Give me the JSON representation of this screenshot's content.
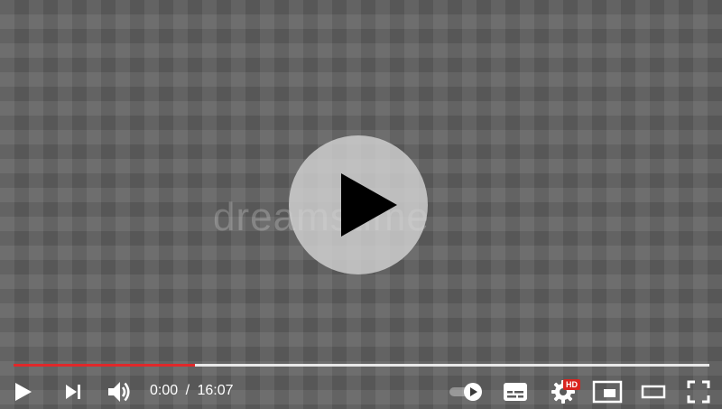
{
  "watermark": "dreamstime",
  "progress": {
    "played_fraction": 0.261
  },
  "time": {
    "current": "0:00",
    "separator": "/",
    "duration": "16:07"
  },
  "badges": {
    "hd": "HD"
  },
  "colors": {
    "progress_played": "#e0282a",
    "hd_badge": "#d9241f"
  },
  "icons": {
    "big_play": "play-icon",
    "play": "play-icon",
    "next": "skip-next-icon",
    "volume": "volume-icon",
    "autoplay": "autoplay-toggle-icon",
    "subtitles": "subtitles-icon",
    "settings": "gear-icon",
    "miniplayer": "miniplayer-icon",
    "theater": "theater-mode-icon",
    "fullscreen": "fullscreen-icon"
  }
}
